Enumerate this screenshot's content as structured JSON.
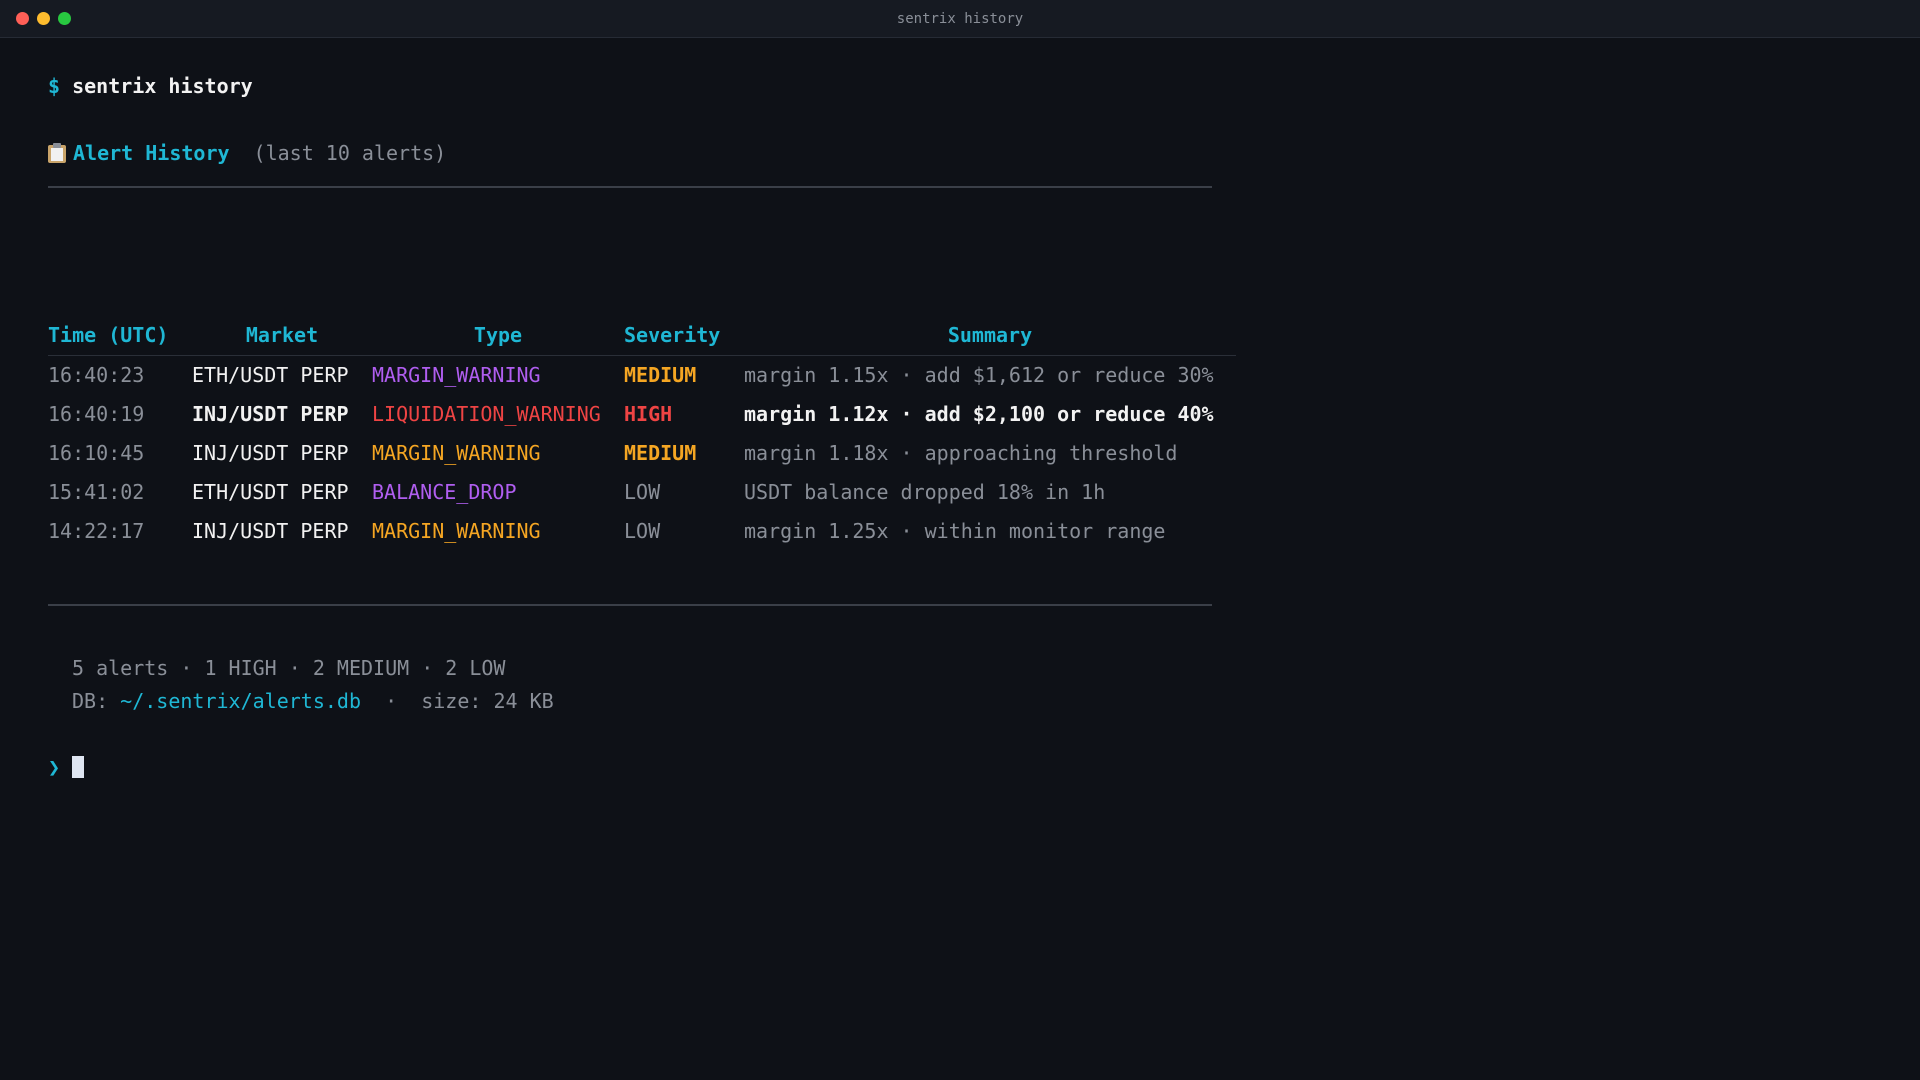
{
  "window": {
    "title": "sentrix history"
  },
  "prompt": {
    "symbol": "$",
    "command": "sentrix history"
  },
  "heading": {
    "icon": "clipboard-icon",
    "title": "Alert History",
    "subtitle": "(last 10 alerts)"
  },
  "table": {
    "headers": {
      "time": "Time (UTC)",
      "market": "Market",
      "type": "Type",
      "severity": "Severity",
      "summary": "Summary"
    },
    "rows": [
      {
        "time": "16:40:23",
        "market": "ETH/USDT PERP",
        "type": "MARGIN_WARNING",
        "type_color": "#b05ef0",
        "severity": "MEDIUM",
        "severity_color": "#f5a623",
        "summary": "margin 1.15x · add $1,612 or reduce 30%",
        "emphasis": false
      },
      {
        "time": "16:40:19",
        "market": "INJ/USDT PERP",
        "type": "LIQUIDATION_WARNING",
        "type_color": "#ef4444",
        "severity": "HIGH",
        "severity_color": "#ef4444",
        "summary": "margin 1.12x · add $2,100 or reduce 40%",
        "emphasis": true
      },
      {
        "time": "16:10:45",
        "market": "INJ/USDT PERP",
        "type": "MARGIN_WARNING",
        "type_color": "#f5a623",
        "severity": "MEDIUM",
        "severity_color": "#f5a623",
        "summary": "margin 1.18x · approaching threshold",
        "emphasis": false
      },
      {
        "time": "15:41:02",
        "market": "ETH/USDT PERP",
        "type": "BALANCE_DROP",
        "type_color": "#b05ef0",
        "severity": "LOW",
        "severity_color": "#8a8f98",
        "summary": "USDT balance dropped 18% in 1h",
        "emphasis": false
      },
      {
        "time": "14:22:17",
        "market": "INJ/USDT PERP",
        "type": "MARGIN_WARNING",
        "type_color": "#f5a623",
        "severity": "LOW",
        "severity_color": "#8a8f98",
        "summary": "margin 1.25x · within monitor range",
        "emphasis": false
      }
    ]
  },
  "footer": {
    "stats": "5 alerts · 1 HIGH · 2 MEDIUM · 2 LOW",
    "db_label": "DB: ",
    "db_path": "~/.sentrix/alerts.db",
    "db_size": "  ·  size: 24 KB"
  },
  "input": {
    "chevron": "❯"
  },
  "colors": {
    "accent": "#1fb7d4",
    "background": "#0e1117",
    "muted": "#8a8f98"
  }
}
